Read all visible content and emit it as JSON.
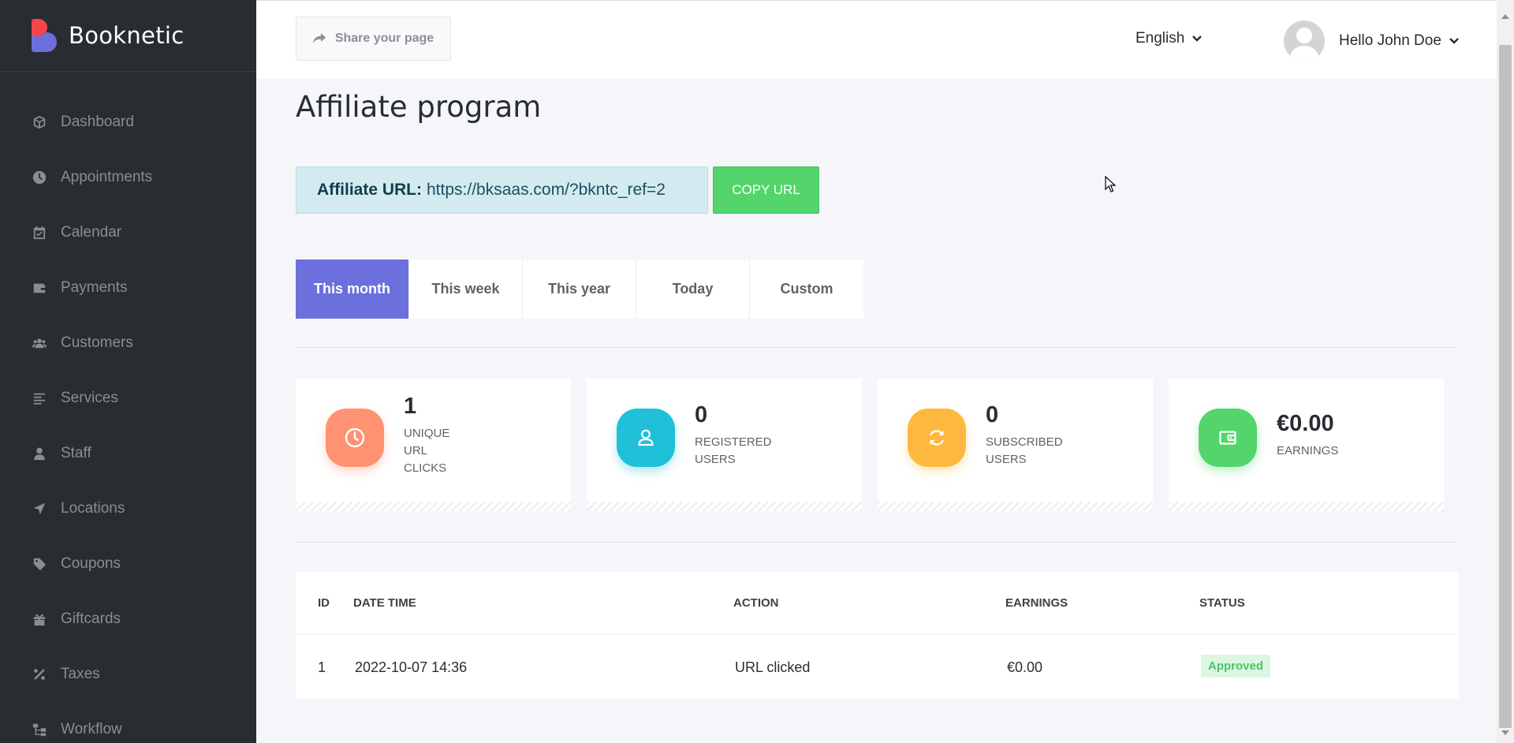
{
  "app": {
    "name": "Booknetic"
  },
  "sidebar": {
    "items": [
      {
        "label": "Dashboard",
        "icon": "cube-icon"
      },
      {
        "label": "Appointments",
        "icon": "clock-icon"
      },
      {
        "label": "Calendar",
        "icon": "calendar-icon"
      },
      {
        "label": "Payments",
        "icon": "wallet-icon"
      },
      {
        "label": "Customers",
        "icon": "users-icon"
      },
      {
        "label": "Services",
        "icon": "list-icon"
      },
      {
        "label": "Staff",
        "icon": "user-icon"
      },
      {
        "label": "Locations",
        "icon": "location-arrow-icon"
      },
      {
        "label": "Coupons",
        "icon": "tag-icon"
      },
      {
        "label": "Giftcards",
        "icon": "gift-icon"
      },
      {
        "label": "Taxes",
        "icon": "percent-icon"
      },
      {
        "label": "Workflow",
        "icon": "workflow-icon"
      }
    ]
  },
  "topbar": {
    "share_label": "Share your page",
    "language": "English",
    "user_greeting": "Hello John Doe"
  },
  "page": {
    "title": "Affiliate program",
    "affiliate_url_label": "Affiliate URL:",
    "affiliate_url": "https://bksaas.com/?bkntc_ref=2",
    "copy_label": "COPY URL"
  },
  "tabs": [
    {
      "label": "This month",
      "active": true
    },
    {
      "label": "This week",
      "active": false
    },
    {
      "label": "This year",
      "active": false
    },
    {
      "label": "Today",
      "active": false
    },
    {
      "label": "Custom",
      "active": false
    }
  ],
  "stats": [
    {
      "value": "1",
      "label": "UNIQUE URL CLICKS",
      "color": "#ff9272",
      "icon": "clock-icon"
    },
    {
      "value": "0",
      "label": "REGISTERED USERS",
      "color": "#20c0d8",
      "icon": "user-icon"
    },
    {
      "value": "0",
      "label": "SUBSCRIBED USERS",
      "color": "#ffb83e",
      "icon": "refresh-icon"
    },
    {
      "value": "€0.00",
      "label": "EARNINGS",
      "color": "#53d56c",
      "icon": "wallet-icon"
    }
  ],
  "table": {
    "headers": {
      "id": "ID",
      "datetime": "DATE TIME",
      "action": "ACTION",
      "earnings": "EARNINGS",
      "status": "STATUS"
    },
    "rows": [
      {
        "id": "1",
        "datetime": "2022-10-07 14:36",
        "action": "URL clicked",
        "earnings": "€0.00",
        "status": "Approved"
      }
    ]
  },
  "colors": {
    "accent": "#6c70dc",
    "sidebar": "#292d32",
    "success": "#53d56c"
  }
}
